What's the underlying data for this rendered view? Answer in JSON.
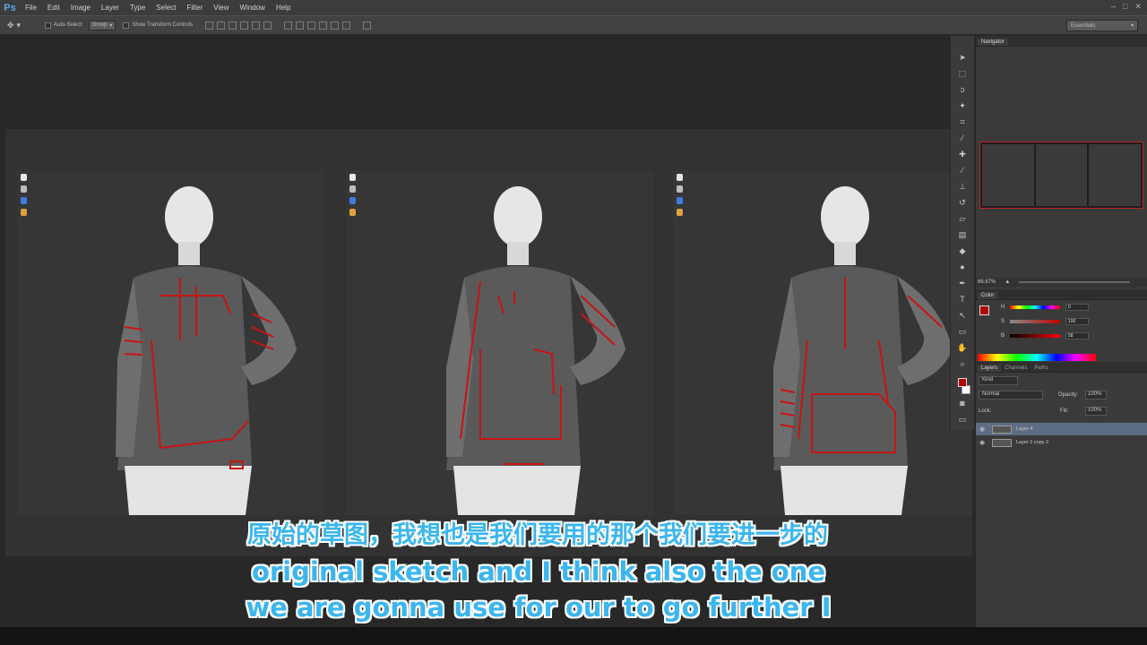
{
  "app": {
    "logo": "Ps",
    "window_controls": [
      "–",
      "□",
      "✕"
    ]
  },
  "menu": [
    "File",
    "Edit",
    "Image",
    "Layer",
    "Type",
    "Select",
    "Filter",
    "View",
    "Window",
    "Help"
  ],
  "options": {
    "auto_select_label": "Auto-Select:",
    "auto_select_value": "Group",
    "show_transform_label": "Show Transform Controls",
    "workspace": "Essentials"
  },
  "tools": [
    "move-icon",
    "marquee-icon",
    "lasso-icon",
    "magic-wand-icon",
    "crop-icon",
    "eyedropper-icon",
    "healing-icon",
    "brush-icon",
    "stamp-icon",
    "history-brush-icon",
    "eraser-icon",
    "gradient-icon",
    "blur-icon",
    "dodge-icon",
    "pen-icon",
    "type-icon",
    "path-select-icon",
    "shape-icon",
    "hand-icon",
    "zoom-icon"
  ],
  "colors": {
    "foreground": "#b00000",
    "background": "#ffffff",
    "sketch_line": "#c81414",
    "subtitle": "#3bb6ee"
  },
  "navigator": {
    "tab": "Navigator",
    "zoom": "66.67%"
  },
  "color_panel": {
    "tab": "Color",
    "h_label": "H",
    "h_value": "0",
    "s_label": "S",
    "s_value": "100",
    "b_label": "B",
    "b_value": "58",
    "pct": "%"
  },
  "layers": {
    "tabs": [
      "Layers",
      "Channels",
      "Paths"
    ],
    "filter": "Kind",
    "blend_mode": "Normal",
    "opacity_label": "Opacity:",
    "opacity_value": "100%",
    "lock_label": "Lock:",
    "fill_label": "Fill:",
    "fill_value": "100%",
    "items": [
      {
        "name": "Layer 4",
        "selected": true
      },
      {
        "name": "Layer 2 copy 2",
        "selected": false
      }
    ]
  },
  "subtitles": {
    "line_cn": "原始的草图，我想也是我们要用的那个我们要进一步的",
    "line_en1": "original sketch and I think also the one",
    "line_en2": "we are gonna use for our to go further I"
  }
}
